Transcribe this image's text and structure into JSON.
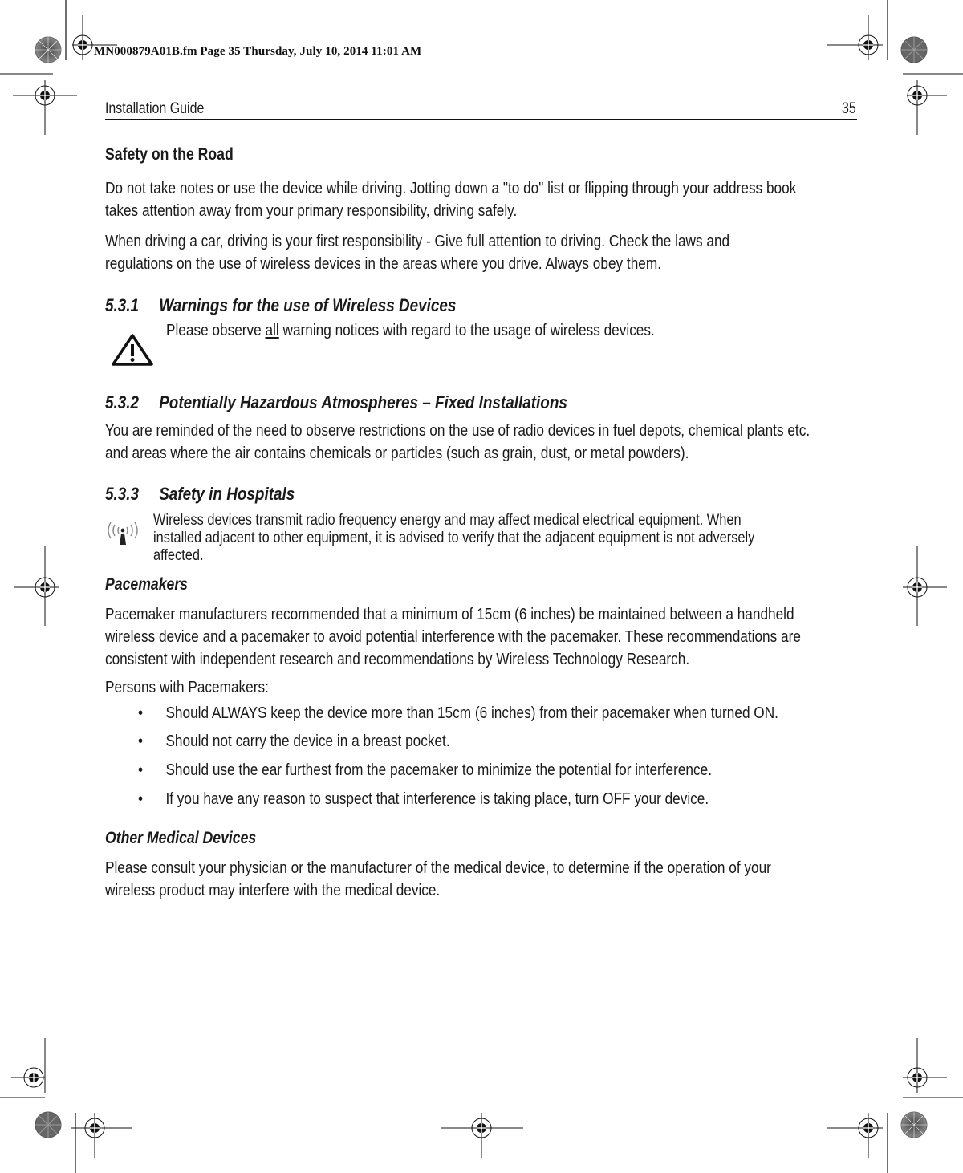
{
  "print_slug": "MN000879A01B.fm  Page 35  Thursday, July 10, 2014  11:01 AM",
  "header": {
    "title": "Installation Guide",
    "page_number": "35"
  },
  "sections": {
    "road": {
      "heading": "Safety on the Road",
      "p1_line1": "Do not take notes or use the device while driving. Jotting down a \"to do\" list or flipping through your address book",
      "p1_line2": "takes attention away from your primary responsibility, driving safely.",
      "p2_line1": "When driving a car, driving is your first responsibility - Give full attention to driving. Check the laws and",
      "p2_line2": "regulations on the use of wireless devices in the areas where you drive. Always obey them."
    },
    "s531": {
      "number": "5.3.1",
      "title": "Warnings for the use of Wireless Devices",
      "icon": "warning-triangle-icon",
      "note_before": "Please observe ",
      "note_emphasis": "all",
      "note_after": " warning notices with regard to the usage of wireless devices."
    },
    "s532": {
      "number": "5.3.2",
      "title": "Potentially Hazardous Atmospheres – Fixed Installations",
      "line1": "You are reminded of the need to observe restrictions on the use of radio devices in fuel depots, chemical plants etc.",
      "line2": "and areas where the air contains chemicals or particles (such as grain, dust, or metal powders)."
    },
    "s533": {
      "number": "5.3.3",
      "title": "Safety in Hospitals",
      "icon": "radio-emission-icon",
      "note_line1": "Wireless devices transmit radio frequency energy and may affect medical electrical equipment. When",
      "note_line2": "installed adjacent to other equipment, it is advised to verify that the adjacent equipment is not adversely",
      "note_line3": "affected."
    },
    "pacemakers": {
      "heading": "Pacemakers",
      "p1_line1": "Pacemaker manufacturers recommended that a minimum of 15cm (6 inches) be maintained between a handheld",
      "p1_line2": "wireless device and a pacemaker to avoid potential interference with the pacemaker. These recommendations are",
      "p1_line3": "consistent with independent research and recommendations by Wireless Technology Research.",
      "intro": "Persons with Pacemakers:",
      "bullets": [
        "Should ALWAYS keep the device more than 15cm (6 inches) from their pacemaker when turned ON.",
        "Should not carry the device in a breast pocket.",
        "Should use the ear furthest from the pacemaker to minimize the potential for interference.",
        "If you have any reason to suspect that interference is taking place, turn OFF your device."
      ]
    },
    "other": {
      "heading": "Other Medical Devices",
      "line1": "Please consult your physician or the manufacturer of the medical device, to determine if the operation of your",
      "line2": "wireless product may interfere with the medical device."
    }
  }
}
